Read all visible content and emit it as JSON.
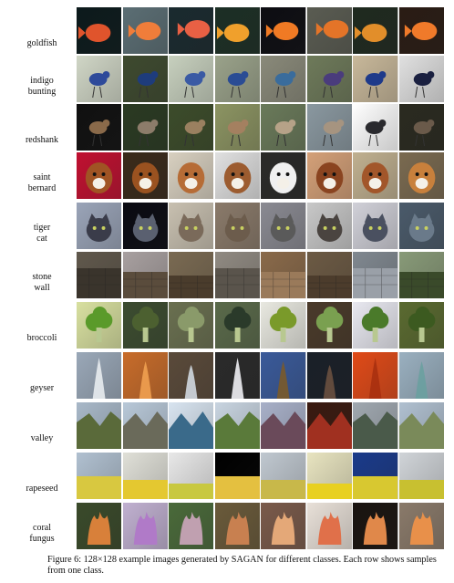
{
  "figure": {
    "rows": [
      {
        "label": "goldfish",
        "bg": [
          "#0c1a1c",
          "#5b6e74",
          "#1a2a2f",
          "#1c2f25",
          "#0d0d12",
          "#5a5c52",
          "#1f2a1f",
          "#2a1c14"
        ],
        "fg": [
          "#e0542c",
          "#f07d3a",
          "#e86044",
          "#f0a02c",
          "#f07a24",
          "#e47428",
          "#e28e2a",
          "#f07a2a"
        ],
        "kind": "fish"
      },
      {
        "label": "indigo\nbunting",
        "bg": [
          "#d0d6c6",
          "#3e4a2f",
          "#c7d0be",
          "#9aa28a",
          "#8a8a7a",
          "#6e7a5a",
          "#c8b89a",
          "#e0e0e0"
        ],
        "fg": [
          "#2e4a9a",
          "#1e3c7c",
          "#3a5aa4",
          "#2a4c94",
          "#3a6c9c",
          "#4a3c7c",
          "#1e3a8a",
          "#1a2040"
        ],
        "kind": "bird"
      },
      {
        "label": "redshank",
        "bg": [
          "#101010",
          "#2a3a22",
          "#3c4c2a",
          "#8c9462",
          "#6a7a5a",
          "#8a98a0",
          "#ffffff",
          "#2a2a20"
        ],
        "fg": [
          "#8a6a4a",
          "#8c7c6a",
          "#9a8060",
          "#a48060",
          "#b6a288",
          "#a69480",
          "#2a2a2e",
          "#6a5a4a"
        ],
        "kind": "bird"
      },
      {
        "label": "saint\nbernard",
        "bg": [
          "#c01030",
          "#3a2a1a",
          "#d8d0c0",
          "#e0e0e0",
          "#2a2a28",
          "#d4a078",
          "#c0b090",
          "#7a6a50"
        ],
        "fg": [
          "#a05424",
          "#9a5220",
          "#b66c36",
          "#9c5c30",
          "#f0f0f0",
          "#8a4420",
          "#a2562a",
          "#c8803c"
        ],
        "kind": "dog"
      },
      {
        "label": "tiger\ncat",
        "bg": [
          "#9aa4b8",
          "#0a0a12",
          "#c8c0b0",
          "#8a7a6a",
          "#8a8a92",
          "#c8c8c8",
          "#d0d0d8",
          "#4a5a6a"
        ],
        "fg": [
          "#3a3c4a",
          "#5a6070",
          "#7a6a5a",
          "#6c5c4c",
          "#5a5a5a",
          "#4a4440",
          "#4a5060",
          "#6a7a8a"
        ],
        "kind": "cat"
      },
      {
        "label": "stone\nwall",
        "bg": [
          "#60584c",
          "#a8a0a0",
          "#7a6a52",
          "#908a82",
          "#8a6a4a",
          "#6c5a44",
          "#808890",
          "#889a78"
        ],
        "fg": [
          "#3a342c",
          "#5a4c3c",
          "#4a3c2c",
          "#5a544c",
          "#9a7a5a",
          "#4c3c2c",
          "#9aa0a8",
          "#3a4a2a"
        ],
        "kind": "wall"
      },
      {
        "label": "broccoli",
        "bg": [
          "#d8e0a0",
          "#3c4c30",
          "#6a7050",
          "#5a6a4a",
          "#e8e8e0",
          "#4a3a2a",
          "#e8e8f0",
          "#5a6a30"
        ],
        "fg": [
          "#5a9a2a",
          "#4c6030",
          "#8a9a6a",
          "#2a3a2a",
          "#7a9a2a",
          "#7aa050",
          "#4a7a2a",
          "#3c5a20"
        ],
        "kind": "broc"
      },
      {
        "label": "geyser",
        "bg": [
          "#9aa8b8",
          "#c86c2a",
          "#5a4a3a",
          "#2a2a2a",
          "#3a5a9a",
          "#1a2028",
          "#e04a18",
          "#9ab0c0"
        ],
        "fg": [
          "#e8ecf0",
          "#f0a050",
          "#d0d8e0",
          "#f0f0f4",
          "#7a5a2a",
          "#6a5040",
          "#a83010",
          "#6aa0a0"
        ],
        "kind": "geyser"
      },
      {
        "label": "valley",
        "bg": [
          "#a8b8c8",
          "#b8c8d8",
          "#d8e4f0",
          "#c8d4e0",
          "#a8b0c8",
          "#3a1a10",
          "#a0a8b0",
          "#b0c0d0"
        ],
        "fg": [
          "#5a6a3a",
          "#6a6a5a",
          "#3a6a8a",
          "#5a7a3a",
          "#6a4a5a",
          "#a03020",
          "#4a5a4a",
          "#7a8a5a"
        ],
        "kind": "valley"
      },
      {
        "label": "rapeseed",
        "bg": [
          "#b0c0d0",
          "#e0e0d8",
          "#e8e8e8",
          "#000000",
          "#c0c8d0",
          "#e8e4c0",
          "#1a3a8a",
          "#d0d4d8"
        ],
        "fg": [
          "#d8c840",
          "#e4c830",
          "#c8c840",
          "#e4c040",
          "#c8b84a",
          "#e8d020",
          "#d8c830",
          "#c8c030"
        ],
        "kind": "field"
      },
      {
        "label": "coral\nfungus",
        "bg": [
          "#3a4a2a",
          "#c0b0d0",
          "#4a6a3a",
          "#6a5a3a",
          "#7a5a4a",
          "#e8e0d8",
          "#1a1410",
          "#8a7a6a"
        ],
        "fg": [
          "#d8803a",
          "#b07ac8",
          "#c0a0b0",
          "#c88050",
          "#e4a878",
          "#e0704a",
          "#e0884a",
          "#e8904a"
        ],
        "kind": "coral"
      }
    ],
    "caption": "Figure 6: 128×128 example images generated by SAGAN for different classes. Each row shows samples from one class."
  }
}
